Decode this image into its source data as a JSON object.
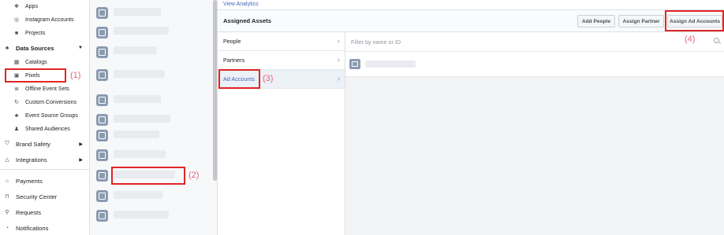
{
  "nav": {
    "items": [
      {
        "label": "Apps",
        "icon": "cube-icon"
      },
      {
        "label": "Instagram Accounts",
        "icon": "instagram-icon"
      },
      {
        "label": "Projects",
        "icon": "briefcase-icon"
      },
      {
        "label": "Data Sources",
        "icon": "people-icon"
      },
      {
        "label": "Catalogs",
        "icon": "grid-icon"
      },
      {
        "label": "Pixels",
        "icon": "code-icon"
      },
      {
        "label": "Offline Event Sets",
        "icon": "list-icon"
      },
      {
        "label": "Custom Conversions",
        "icon": "refresh-icon"
      },
      {
        "label": "Event Source Groups",
        "icon": "group-icon"
      },
      {
        "label": "Shared Audiences",
        "icon": "audience-icon"
      },
      {
        "label": "Brand Safety",
        "icon": "shield-icon"
      },
      {
        "label": "Integrations",
        "icon": "integrations-icon"
      },
      {
        "label": "Payments",
        "icon": "bank-icon"
      },
      {
        "label": "Security Center",
        "icon": "lock-icon"
      },
      {
        "label": "Requests",
        "icon": "request-icon"
      },
      {
        "label": "Notifications",
        "icon": "notification-icon"
      }
    ]
  },
  "annotations": {
    "a1": "(1)",
    "a2": "(2)",
    "a3": "(3)",
    "a4": "(4)"
  },
  "panel": {
    "view_analytics": "View Analytics",
    "title": "Assigned Assets",
    "buttons": {
      "add_people": "Add People",
      "assign_partner": "Assign Partner",
      "assign_ad_accounts": "Assign Ad Accounts"
    },
    "categories": [
      "People",
      "Partners",
      "Ad Accounts"
    ],
    "filter_placeholder": "Filter by name or ID"
  },
  "colors": {
    "highlight_box": "#e02525",
    "annotation_text": "#e8637c",
    "link": "#4267b2"
  }
}
